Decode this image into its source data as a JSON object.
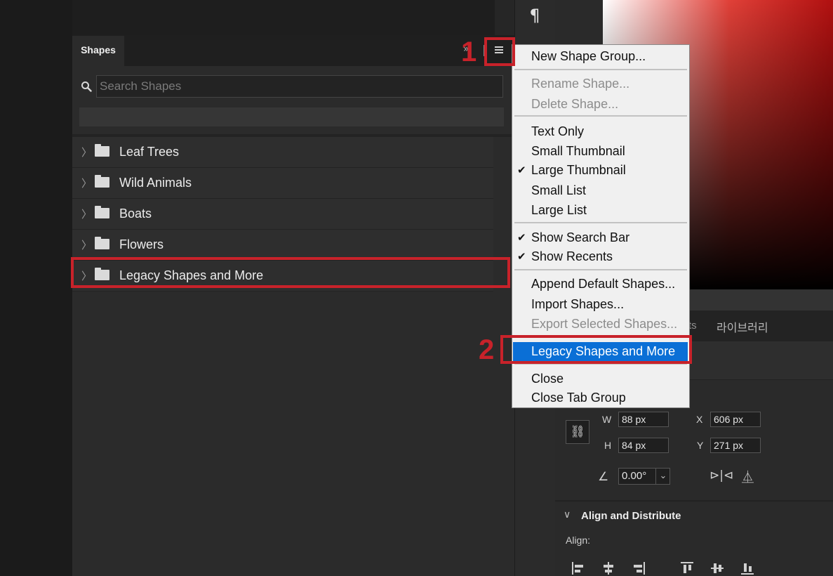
{
  "toolbar": {
    "paragraph_icon": "¶"
  },
  "shapes_panel": {
    "tab_label": "Shapes",
    "collapse_icon": "»",
    "search_placeholder": "Search Shapes",
    "groups": [
      {
        "label": "Leaf Trees"
      },
      {
        "label": "Wild Animals"
      },
      {
        "label": "Boats"
      },
      {
        "label": "Flowers"
      },
      {
        "label": "Legacy Shapes and More"
      }
    ]
  },
  "annotations": {
    "step1": "1",
    "step2": "2",
    "highlight_color": "#c8222a"
  },
  "menu": {
    "new_group": "New Shape Group...",
    "rename": "Rename Shape...",
    "delete": "Delete Shape...",
    "text_only": "Text Only",
    "small_thumb": "Small Thumbnail",
    "large_thumb": "Large Thumbnail",
    "small_list": "Small List",
    "large_list": "Large List",
    "show_search": "Show Search Bar",
    "show_recents": "Show Recents",
    "append_default": "Append Default Shapes...",
    "import": "Import Shapes...",
    "export": "Export Selected Shapes...",
    "legacy": "Legacy Shapes and More",
    "close": "Close",
    "close_tab_group": "Close Tab Group",
    "check": "✔",
    "selected_color": "#0a6fd6"
  },
  "properties": {
    "tab_fragment": "ts",
    "library_tab": "라이브러리",
    "link_icon": "⛓",
    "w_label": "W",
    "w_value": "88 px",
    "h_label": "H",
    "h_value": "84 px",
    "x_label": "X",
    "x_value": "606 px",
    "y_label": "Y",
    "y_value": "271 px",
    "angle_icon": "∠",
    "angle_value": "0.00°",
    "angle_caret": "⌄",
    "flip_h_icon": "⊳|⊲",
    "flip_v_icon": "⏅",
    "align_chevron": "∨",
    "align_title": "Align and Distribute",
    "align_label": "Align:"
  }
}
